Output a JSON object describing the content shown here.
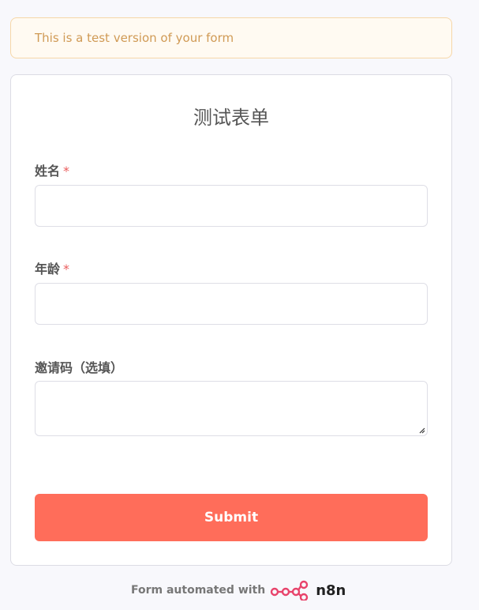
{
  "banner": {
    "text": "This is a test version of your form"
  },
  "form": {
    "title": "测试表单",
    "fields": [
      {
        "label": "姓名",
        "required_mark": "*",
        "value": ""
      },
      {
        "label": "年龄",
        "required_mark": "*",
        "value": ""
      },
      {
        "label": "邀请码（选填）",
        "value": ""
      }
    ],
    "submit_label": "Submit"
  },
  "footer": {
    "text": "Form automated with",
    "logo_text": "n8n",
    "logo_icon": "n8n-logo-icon"
  },
  "colors": {
    "accent": "#ff6d5a",
    "required": "#ea5d5d",
    "banner_text": "#d09a55",
    "banner_border": "#f6d7a8"
  }
}
